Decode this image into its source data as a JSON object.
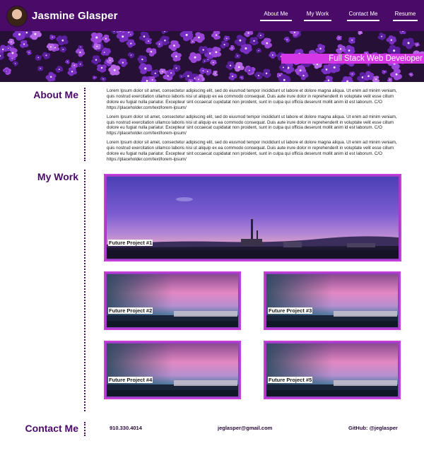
{
  "header": {
    "title": "Jasmine Glasper",
    "nav": [
      "About Me",
      "My Work",
      "Contact Me",
      "Resume"
    ]
  },
  "hero": {
    "tagline": "Full Stack Web Developer"
  },
  "about": {
    "heading": "About Me",
    "paragraphs": [
      "Lorem Ipsum dolor sit amet, consectetur adipiscing elit, sed do eiusmod tempor incididunt ut labore et dolore magna aliqua. Ut enim ad minim veniam, quis nostrud exercitation ullamco laboris nisi ut aliquip ex ea commodo consequat. Duis aute irure dolor in reprehenderit in voluptate velit esse cillum dolore eu fugiat nulla pariatur. Excepteur sint occaecat cupidatat non proident, sunt in culpa qui officia deserunt mollit anim id est laborum. C/O https://placeholder.com/text/lorem-ipsum/",
      "Lorem Ipsum dolor sit amet, consectetur adipiscing elit, sed do eiusmod tempor incididunt ut labore et dolore magna aliqua. Ut enim ad minim veniam, quis nostrud exercitation ullamco laboris nisi ut aliquip ex ea commodo consequat. Duis aute irure dolor in reprehenderit in voluptate velit esse cillum dolore eu fugiat nulla pariatur. Excepteur sint occaecat cupidatat non proident, sunt in culpa qui officia deserunt mollit anim id est laborum. C/O https://placeholder.com/text/lorem-ipsum/",
      "Lorem Ipsum dolor sit amet, consectetur adipiscing elit, sed do eiusmod tempor incididunt ut labore et dolore magna aliqua. Ut enim ad minim veniam, quis nostrud exercitation ullamco laboris nisi ut aliquip ex ea commodo consequat. Duis aute irure dolor in reprehenderit in voluptate velit esse cillum dolore eu fugiat nulla pariatur. Excepteur sint occaecat cupidatat non proident, sunt in culpa qui officia deserunt mollit anim id est laborum. C/O https://placeholder.com/text/lorem-ipsum/"
    ]
  },
  "work": {
    "heading": "My Work",
    "projects": [
      "Future Project #1",
      "Future Project #2",
      "Future Project #3",
      "Future Project #4",
      "Future Project #5"
    ]
  },
  "contact": {
    "heading": "Contact Me",
    "phone": "910.330.4014",
    "email": "jeglasper@gmail.com",
    "github": "GitHub: @jeglasper"
  },
  "colors": {
    "brand": "#4a0a68",
    "accent": "#d637e6",
    "card_border": "#c83fdc"
  }
}
